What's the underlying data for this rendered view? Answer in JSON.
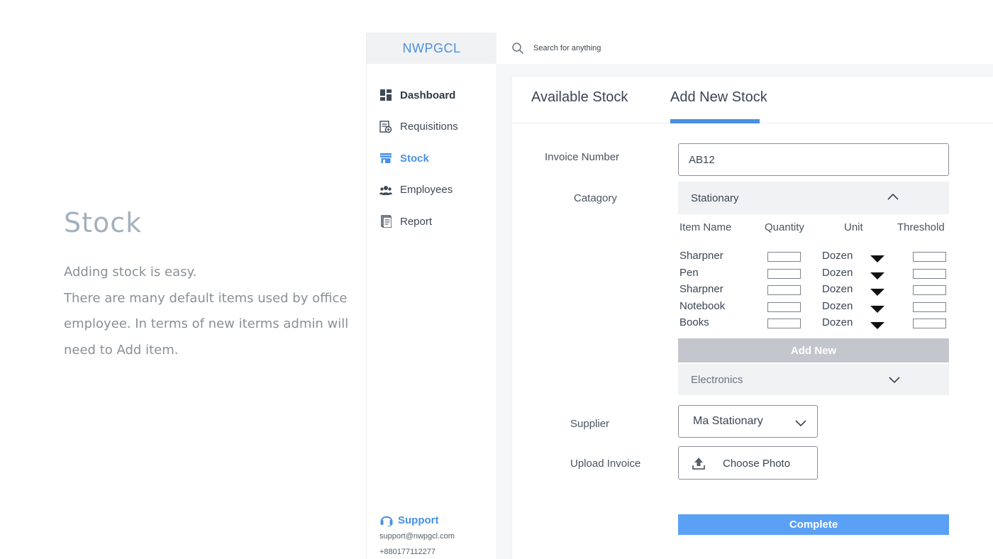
{
  "intro": {
    "title": "Stock",
    "lines": [
      "Adding stock is easy.",
      "There are many default items used by office",
      "employee. In terms of new iterms admin will",
      "need to Add item."
    ]
  },
  "app": {
    "brand": "NWPGCL",
    "search": {
      "placeholder": "Search for anything",
      "icon": "search-icon"
    },
    "sidebar": {
      "items": [
        {
          "label": "Dashboard",
          "icon": "dashboard-icon",
          "active": false
        },
        {
          "label": "Requisitions",
          "icon": "requisitions-icon",
          "active": false
        },
        {
          "label": "Stock",
          "icon": "stock-icon",
          "active": true
        },
        {
          "label": "Employees",
          "icon": "employees-icon",
          "active": false
        },
        {
          "label": "Report",
          "icon": "report-icon",
          "active": false
        }
      ],
      "support": {
        "label": "Support",
        "icon": "headset-icon",
        "email": "support@nwpgcl.com",
        "phone": "+880177112277"
      }
    },
    "tabs": [
      {
        "label": "Available Stock",
        "active": false
      },
      {
        "label": "Add New Stock",
        "active": true
      }
    ],
    "form": {
      "invoice_label": "Invoice Number",
      "invoice_value": "AB12",
      "category_label": "Catagory",
      "category_value": "Stationary",
      "table": {
        "headers": [
          "Item Name",
          "Quantity",
          "Unit",
          "Threshold"
        ],
        "rows": [
          {
            "name": "Sharpner",
            "unit": "Dozen"
          },
          {
            "name": "Pen",
            "unit": "Dozen"
          },
          {
            "name": "Sharpner",
            "unit": "Dozen"
          },
          {
            "name": "Notebook",
            "unit": "Dozen"
          },
          {
            "name": "Books",
            "unit": "Dozen"
          }
        ]
      },
      "add_new_label": "Add New",
      "second_category_value": "Electronics",
      "supplier_label": "Supplier",
      "supplier_value": "Ma Stationary",
      "upload_label": "Upload Invoice",
      "upload_button_label": "Choose Photo",
      "complete_label": "Complete"
    },
    "colors": {
      "accent": "#4a90e2",
      "complete_button": "#5aa0f5",
      "add_new_button": "#c3c6cc",
      "select_bg": "#f1f2f4"
    }
  }
}
